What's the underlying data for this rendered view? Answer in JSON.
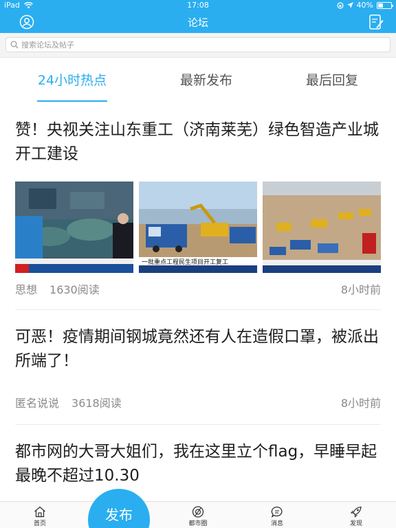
{
  "status_bar": {
    "carrier": "iPad",
    "time": "17:08",
    "battery": "40%",
    "battery_level": 0.4
  },
  "nav": {
    "title": "论坛",
    "user_icon": "user-circle-icon",
    "compose_icon": "compose-icon"
  },
  "search": {
    "placeholder": "搜索论坛及帖子"
  },
  "tabs": [
    {
      "label": "24小时热点",
      "active": true
    },
    {
      "label": "最新发布",
      "active": false
    },
    {
      "label": "最后回复",
      "active": false
    }
  ],
  "posts": [
    {
      "title": "赞！央视关注山东重工（济南莱芜）绿色智造产业城开工建设",
      "author": "思想",
      "reads": "1630阅读",
      "time": "8小时前",
      "has_images": true
    },
    {
      "title": "可恶！疫情期间钢城竟然还有人在造假口罩，被派出所端了！",
      "author": "匿名说说",
      "reads": "3618阅读",
      "time": "8小时前",
      "has_images": false
    },
    {
      "title": "都市网的大哥大姐们，我在这里立个flag，早睡早起最晚不超过10.30",
      "has_images": false
    }
  ],
  "image_captions": {
    "img2": "一批重点工程民生项目开工复工"
  },
  "tabbar": {
    "home": "首页",
    "publish": "发布",
    "circle": "都市圈",
    "messages": "消息",
    "discover": "发现"
  },
  "colors": {
    "accent": "#2aaef0",
    "text": "#1e1e1e",
    "meta": "#8a8a8a"
  }
}
